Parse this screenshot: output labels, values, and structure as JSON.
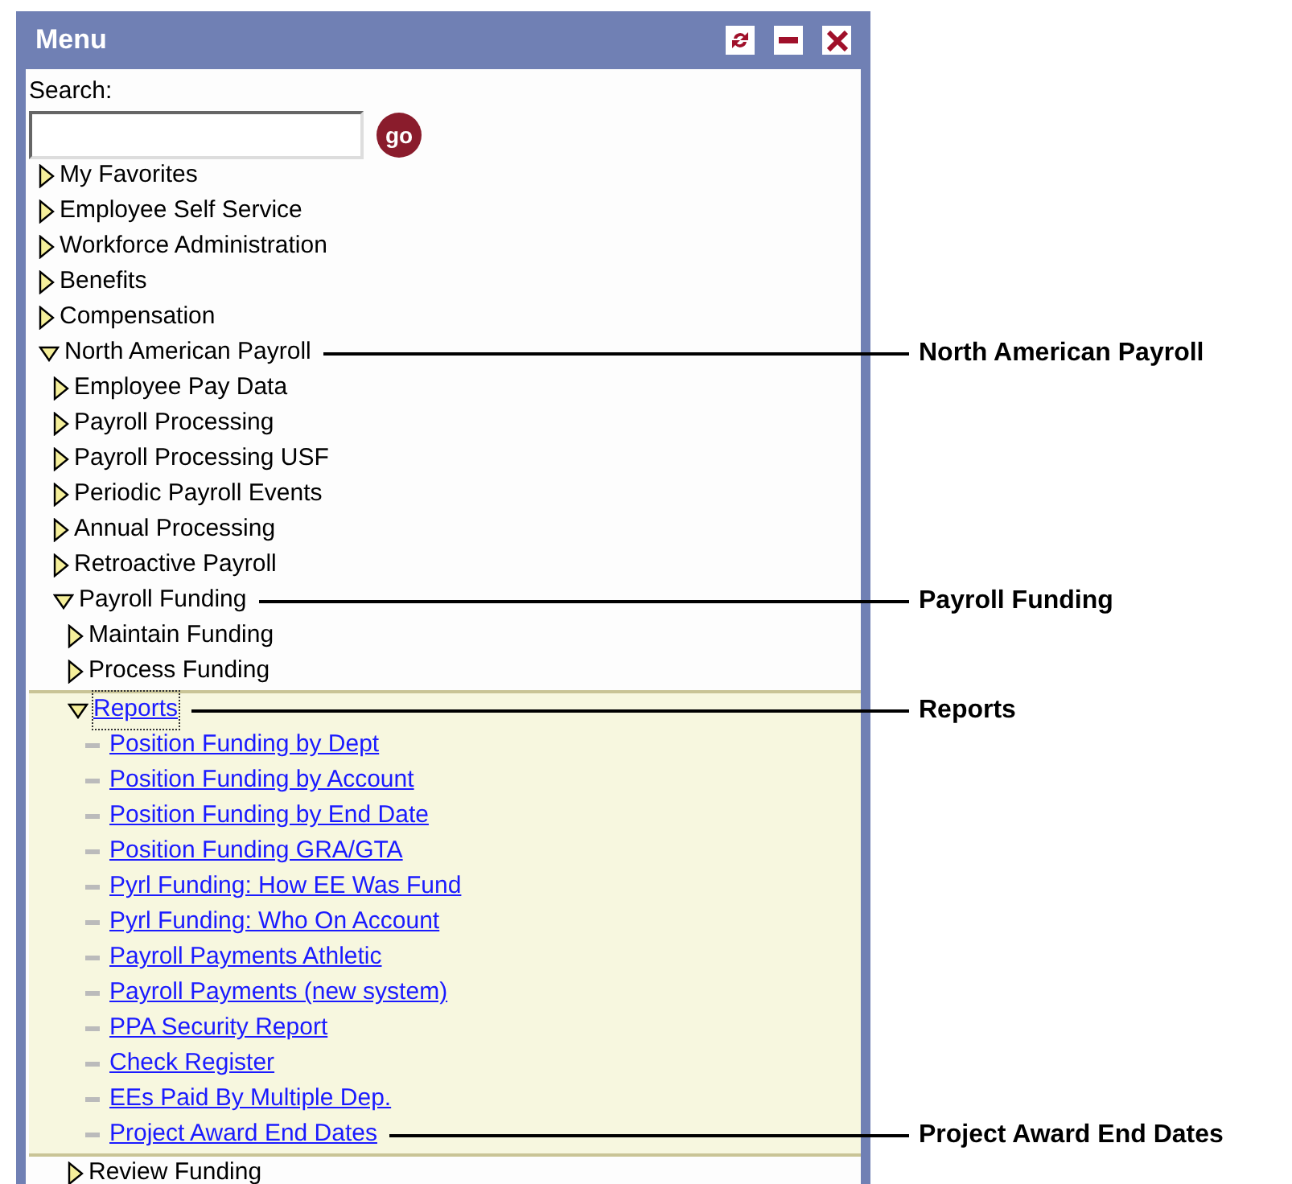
{
  "panel": {
    "title": "Menu",
    "search": {
      "label": "Search:",
      "button": "go"
    },
    "tree": [
      {
        "label": "My Favorites",
        "kind": "folder",
        "expanded": false,
        "selected": false
      },
      {
        "label": "Employee Self Service",
        "kind": "folder",
        "expanded": false,
        "selected": false
      },
      {
        "label": "Workforce Administration",
        "kind": "folder",
        "expanded": false,
        "selected": false
      },
      {
        "label": "Benefits",
        "kind": "folder",
        "expanded": false,
        "selected": false
      },
      {
        "label": "Compensation",
        "kind": "folder",
        "expanded": false,
        "selected": false
      },
      {
        "label": "North American Payroll",
        "kind": "folder",
        "expanded": true,
        "selected": false,
        "callout": "North American Payroll",
        "children": [
          {
            "label": "Employee Pay Data",
            "kind": "folder",
            "expanded": false,
            "selected": false
          },
          {
            "label": "Payroll Processing",
            "kind": "folder",
            "expanded": false,
            "selected": false
          },
          {
            "label": "Payroll Processing USF",
            "kind": "folder",
            "expanded": false,
            "selected": false
          },
          {
            "label": "Periodic Payroll Events",
            "kind": "folder",
            "expanded": false,
            "selected": false
          },
          {
            "label": "Annual Processing",
            "kind": "folder",
            "expanded": false,
            "selected": false
          },
          {
            "label": "Retroactive Payroll",
            "kind": "folder",
            "expanded": false,
            "selected": false
          },
          {
            "label": "Payroll Funding",
            "kind": "folder",
            "expanded": true,
            "selected": false,
            "callout": "Payroll Funding",
            "children": [
              {
                "label": "Maintain Funding",
                "kind": "folder",
                "expanded": false,
                "selected": false
              },
              {
                "label": "Process Funding",
                "kind": "folder",
                "expanded": false,
                "selected": false
              },
              {
                "label": "Reports",
                "kind": "folder",
                "expanded": true,
                "selected": true,
                "callout": "Reports",
                "children": [
                  {
                    "label": "Position Funding by Dept",
                    "kind": "report"
                  },
                  {
                    "label": "Position Funding by Account",
                    "kind": "report"
                  },
                  {
                    "label": "Position Funding by End Date",
                    "kind": "report"
                  },
                  {
                    "label": "Position Funding GRA/GTA",
                    "kind": "report"
                  },
                  {
                    "label": "Pyrl Funding: How EE Was Fund",
                    "kind": "report"
                  },
                  {
                    "label": "Pyrl Funding: Who On Account",
                    "kind": "report"
                  },
                  {
                    "label": "Payroll Payments Athletic",
                    "kind": "report"
                  },
                  {
                    "label": "Payroll Payments (new system)",
                    "kind": "report"
                  },
                  {
                    "label": "PPA Security Report",
                    "kind": "report"
                  },
                  {
                    "label": "Check Register",
                    "kind": "report"
                  },
                  {
                    "label": "EEs Paid By Multiple Dep.",
                    "kind": "report"
                  },
                  {
                    "label": "Project Award End Dates",
                    "kind": "report",
                    "callout": "Project Award End Dates"
                  }
                ]
              },
              {
                "label": "Review Funding",
                "kind": "folder",
                "expanded": false,
                "selected": false
              }
            ]
          }
        ]
      }
    ]
  }
}
